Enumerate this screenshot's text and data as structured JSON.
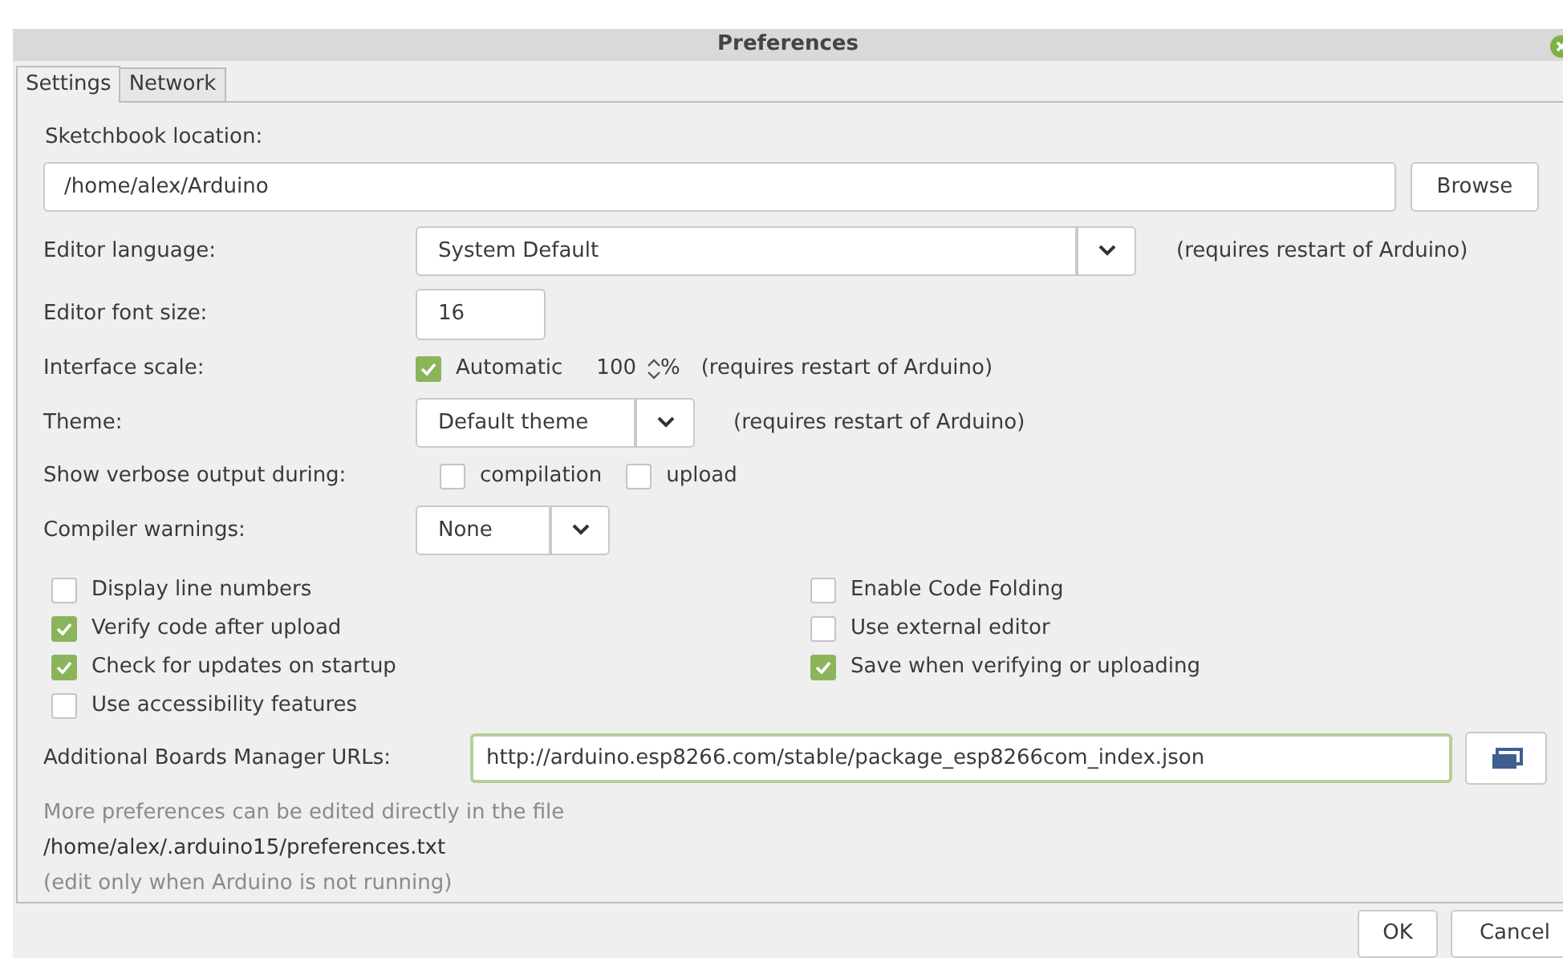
{
  "window": {
    "title": "Preferences"
  },
  "tabs": [
    {
      "label": "Settings",
      "selected": true
    },
    {
      "label": "Network",
      "selected": false
    }
  ],
  "sketchbook": {
    "label": "Sketchbook location:",
    "value": "/home/alex/Arduino",
    "button": "Browse"
  },
  "rows": [
    {
      "kind": "dropdown",
      "label": "Editor language:",
      "value": "System Default",
      "note": "(requires restart of Arduino)"
    },
    {
      "kind": "number",
      "label": "Editor font size:",
      "value": "16"
    },
    {
      "kind": "scale",
      "label": "Interface scale:",
      "option": "Automatic",
      "checked": true,
      "value": "100",
      "unit": "%",
      "note": "(requires restart of Arduino)"
    },
    {
      "kind": "dropdown",
      "label": "Theme:",
      "value": "Default theme",
      "note": "(requires restart of Arduino)"
    },
    {
      "kind": "checks",
      "label": "Show verbose output during:",
      "options": [
        {
          "label": "compilation",
          "checked": false
        },
        {
          "label": "upload",
          "checked": false
        }
      ]
    },
    {
      "kind": "dropdown",
      "label": "Compiler warnings:",
      "value": "None"
    }
  ],
  "options_left": [
    {
      "label": "Display line numbers",
      "checked": false
    },
    {
      "label": "Verify code after upload",
      "checked": true
    },
    {
      "label": "Check for updates on startup",
      "checked": true
    },
    {
      "label": "Use accessibility features",
      "checked": false
    }
  ],
  "options_right": [
    {
      "label": "Enable Code Folding",
      "checked": false
    },
    {
      "label": "Use external editor",
      "checked": false
    },
    {
      "label": "Save when verifying or uploading",
      "checked": true
    }
  ],
  "boards_urls": {
    "label": "Additional Boards Manager URLs:",
    "value": "http://arduino.esp8266.com/stable/package_esp8266com_index.json"
  },
  "notes": [
    {
      "kind": "hint",
      "text": "More preferences can be edited directly in the file"
    },
    {
      "kind": "path",
      "text": "/home/alex/.arduino15/preferences.txt"
    },
    {
      "kind": "hint",
      "text": "(edit only when Arduino is not running)"
    }
  ],
  "buttons": [
    "OK",
    "Cancel"
  ]
}
